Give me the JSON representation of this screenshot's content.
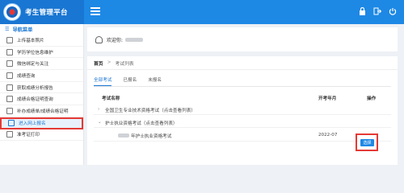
{
  "header": {
    "title": "考生管理平台",
    "icons": [
      "menu-icon",
      "lock-icon",
      "logout-icon",
      "power-icon"
    ]
  },
  "sidebar": {
    "nav_title": "导航菜单",
    "items": [
      {
        "label": "上传基本照片"
      },
      {
        "label": "学历学位信息维护"
      },
      {
        "label": "微信绑定与关注"
      },
      {
        "label": "成绩查询"
      },
      {
        "label": "获取成绩分析报告"
      },
      {
        "label": "成绩合格证明查询"
      },
      {
        "label": "补办成绩单/成绩合格证明"
      },
      {
        "label": "进入网上报名"
      },
      {
        "label": "准考证打印"
      }
    ]
  },
  "welcome": {
    "text": "欢迎你:"
  },
  "breadcrumb": {
    "home": "首页",
    "sep": ">",
    "current": "考试列表"
  },
  "tabs": [
    "全部考试",
    "已报名",
    "未报名"
  ],
  "table": {
    "headers": {
      "name": "考试名称",
      "date": "开考年月",
      "action": "操作"
    },
    "groups": [
      {
        "chev": "›",
        "title": "全国卫生专业技术资格考试（点击查看列表）"
      },
      {
        "chev": "⌄",
        "title": "护士执业资格考试（点击查看列表）"
      }
    ],
    "item": {
      "name": "年护士执业资格考试",
      "date": "2022-07",
      "action": "选择"
    }
  },
  "colors": {
    "primary": "#1e88e5",
    "highlight": "#e53935"
  }
}
